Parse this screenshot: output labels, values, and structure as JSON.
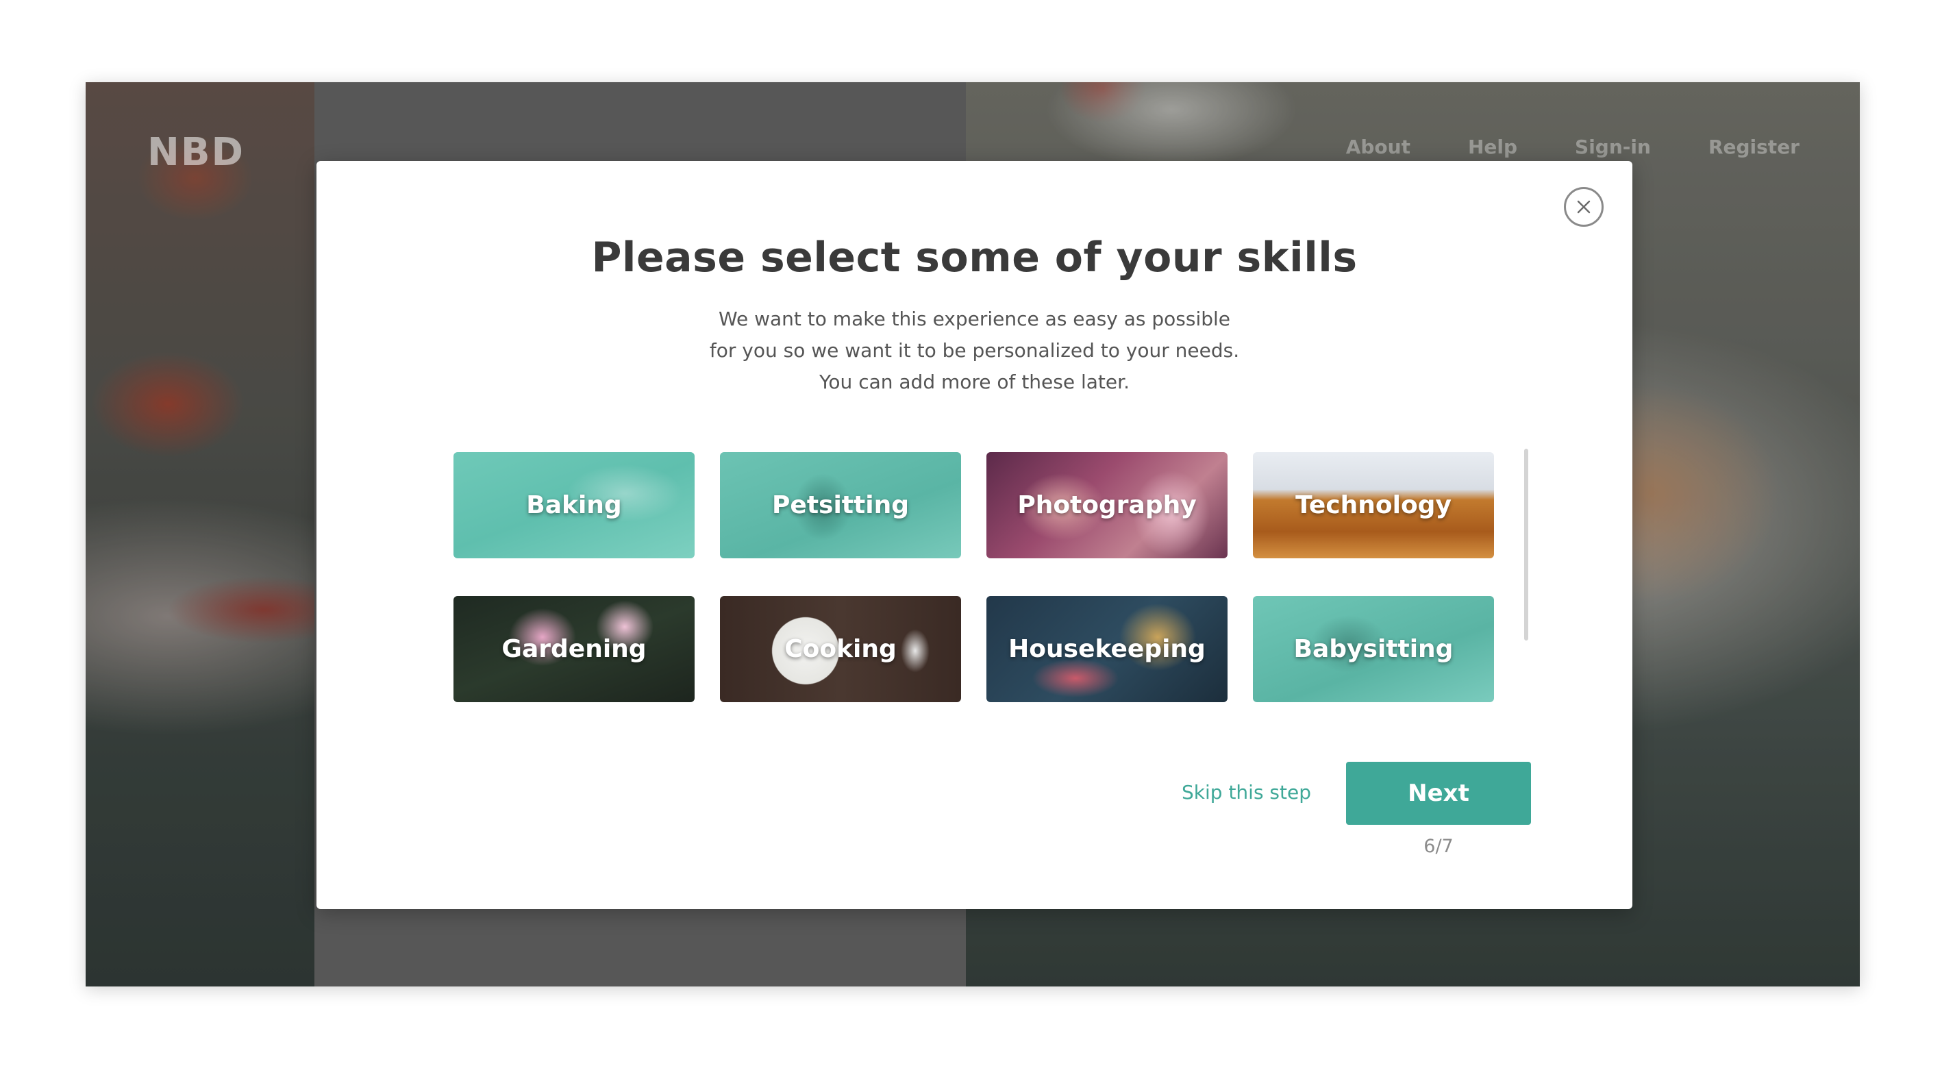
{
  "app": {
    "logo": "NBD",
    "nav": [
      "About",
      "Help",
      "Sign-in",
      "Register"
    ]
  },
  "modal": {
    "title": "Please select some of your skills",
    "subtitle_lines": [
      "We want to make this experience as easy as possible",
      "for you so we want it to be personalized to your needs.",
      "You can add more of these later."
    ],
    "skills": [
      "Baking",
      "Petsitting",
      "Photography",
      "Technology",
      "Gardening",
      "Cooking",
      "Housekeeping",
      "Babysitting"
    ],
    "skip_label": "Skip this step",
    "next_label": "Next",
    "step_indicator": "6/7",
    "close_icon": "close-icon"
  },
  "colors": {
    "accent": "#3fa898",
    "title_text": "#3a3a3a",
    "body_text": "#555555",
    "step_text": "#8c8c8c"
  }
}
